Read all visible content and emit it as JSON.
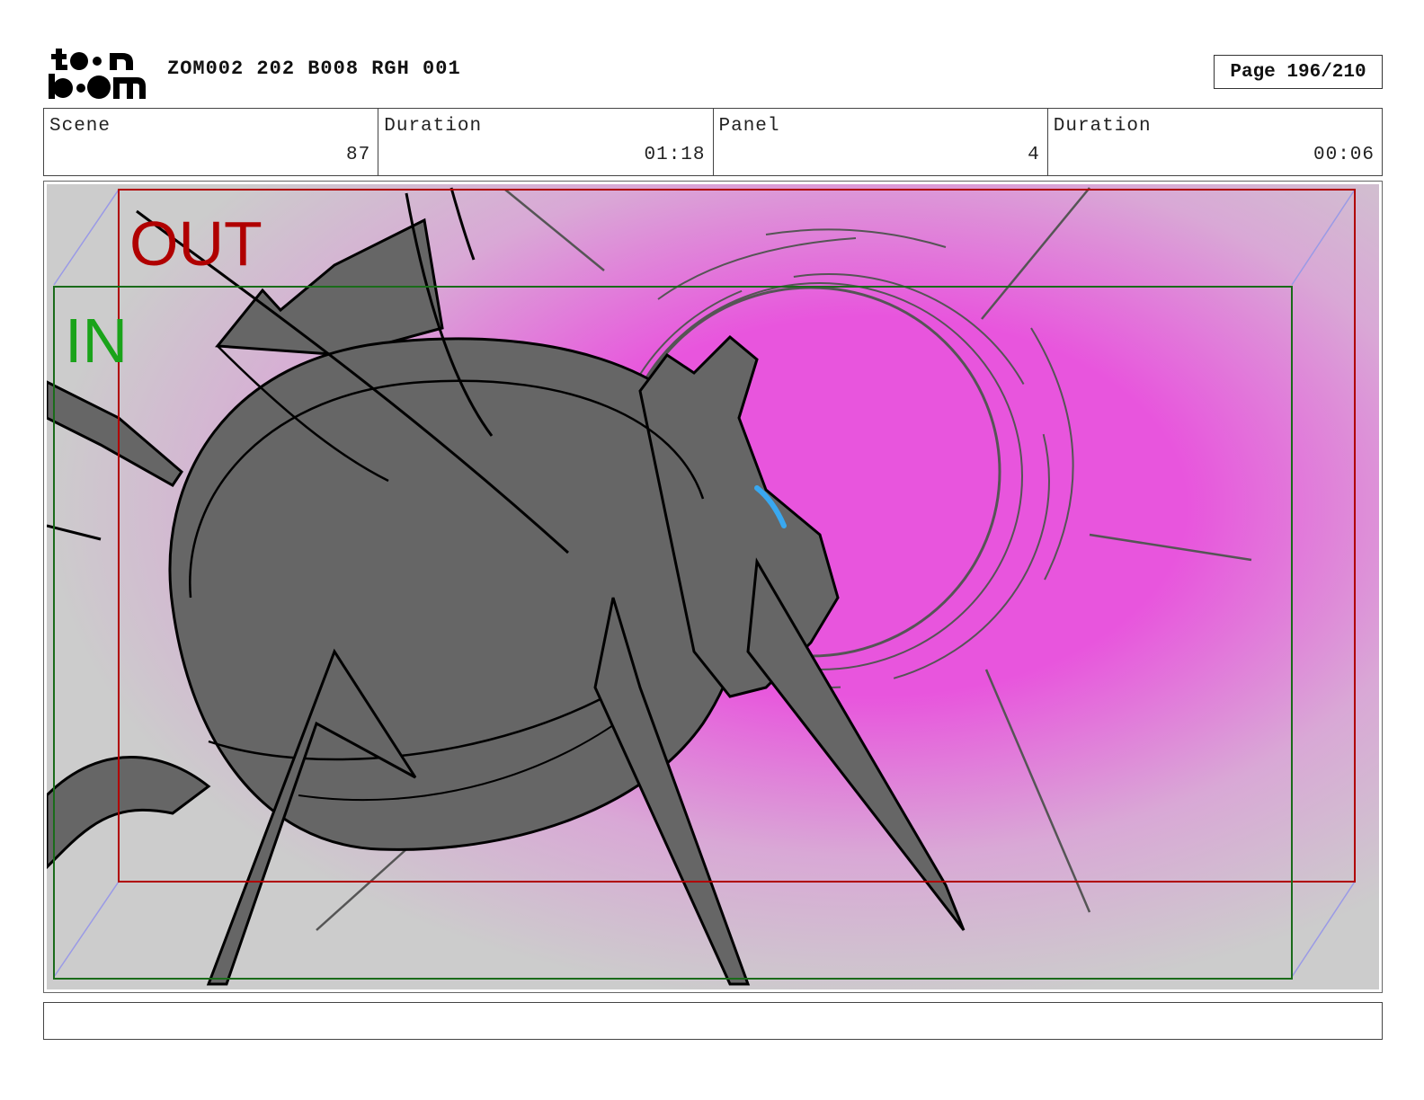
{
  "header": {
    "logo_text": "toon boom",
    "document_title": "ZOM002 202 B008 RGH 001",
    "page_label": "Page 196/210"
  },
  "info": {
    "scene_label": "Scene",
    "scene_value": "87",
    "scene_duration_label": "Duration",
    "scene_duration_value": "01:18",
    "panel_label": "Panel",
    "panel_value": "4",
    "panel_duration_label": "Duration",
    "panel_duration_value": "00:06"
  },
  "panel": {
    "out_label": "OUT",
    "in_label": "IN",
    "colors": {
      "background": "#cccccc",
      "glow": "#e855dd",
      "creature": "#666666",
      "out_frame": "#b00000",
      "in_frame": "#1a6b1a",
      "camera_path": "#9a9ae6",
      "eye_accent": "#39a8f0"
    }
  },
  "caption": {
    "text": ""
  }
}
